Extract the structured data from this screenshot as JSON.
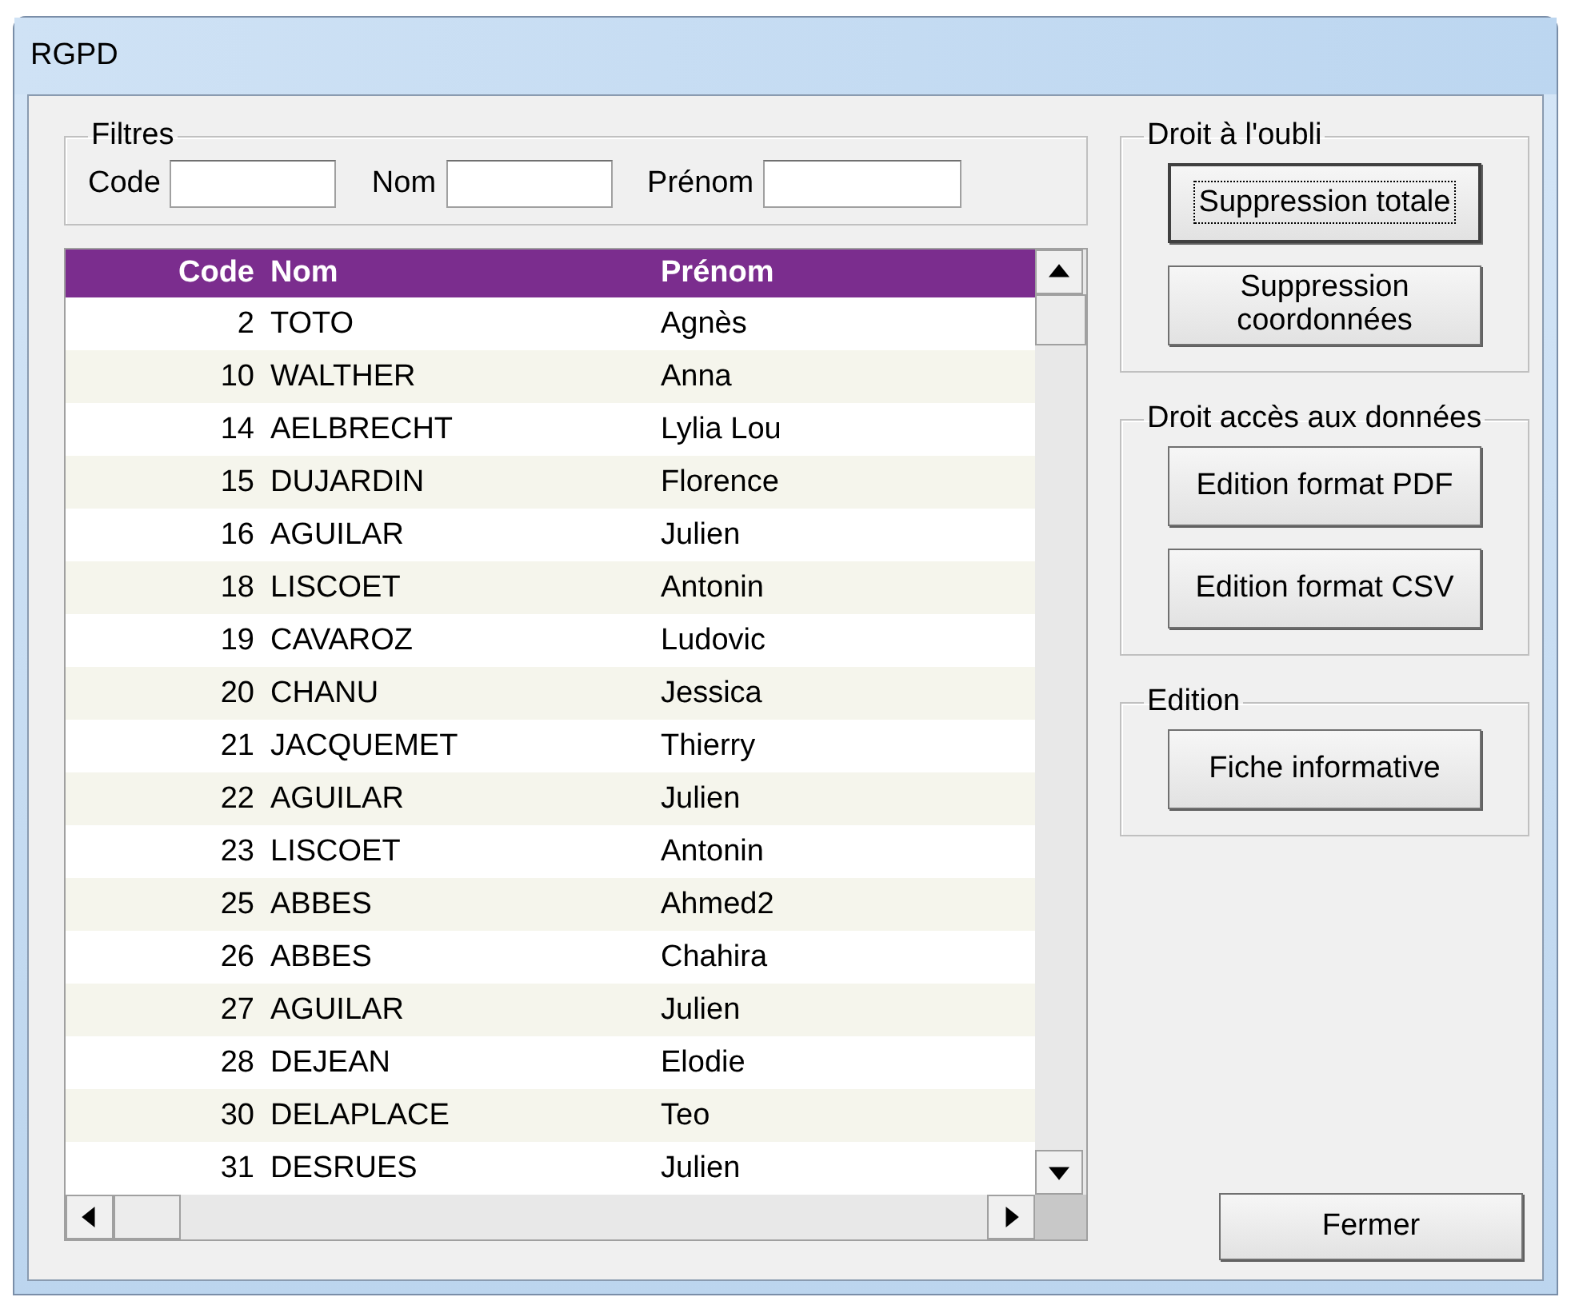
{
  "window": {
    "title": "RGPD"
  },
  "filters": {
    "title": "Filtres",
    "fields": [
      {
        "label": "Code"
      },
      {
        "label": "Nom"
      },
      {
        "label": "Prénom"
      }
    ]
  },
  "table": {
    "columns": [
      "Code",
      "Nom",
      "Prénom"
    ],
    "rows": [
      [
        "2",
        "TOTO",
        "Agnès"
      ],
      [
        "10",
        "WALTHER",
        "Anna"
      ],
      [
        "14",
        "AELBRECHT",
        "Lylia Lou"
      ],
      [
        "15",
        "DUJARDIN",
        "Florence"
      ],
      [
        "16",
        "AGUILAR",
        "Julien"
      ],
      [
        "18",
        "LISCOET",
        "Antonin"
      ],
      [
        "19",
        "CAVAROZ",
        "Ludovic"
      ],
      [
        "20",
        "CHANU",
        "Jessica"
      ],
      [
        "21",
        "JACQUEMET",
        "Thierry"
      ],
      [
        "22",
        "AGUILAR",
        "Julien"
      ],
      [
        "23",
        "LISCOET",
        "Antonin"
      ],
      [
        "25",
        "ABBES",
        "Ahmed2"
      ],
      [
        "26",
        "ABBES",
        "Chahira"
      ],
      [
        "27",
        "AGUILAR",
        "Julien"
      ],
      [
        "28",
        "DEJEAN",
        "Elodie"
      ],
      [
        "30",
        "DELAPLACE",
        "Teo"
      ],
      [
        "31",
        "DESRUES",
        "Julien"
      ]
    ]
  },
  "groups": [
    {
      "title": "Droit à l'oubli",
      "buttons": [
        {
          "label": "Suppression totale",
          "focused": true
        },
        {
          "label": "Suppression coordonnées",
          "focused": false
        }
      ]
    },
    {
      "title": "Droit accès aux données",
      "buttons": [
        {
          "label": "Edition format PDF",
          "focused": false
        },
        {
          "label": "Edition format CSV",
          "focused": false
        }
      ]
    },
    {
      "title": "Edition",
      "buttons": [
        {
          "label": "Fiche informative",
          "focused": false
        }
      ]
    }
  ],
  "close_button": {
    "label": "Fermer"
  }
}
